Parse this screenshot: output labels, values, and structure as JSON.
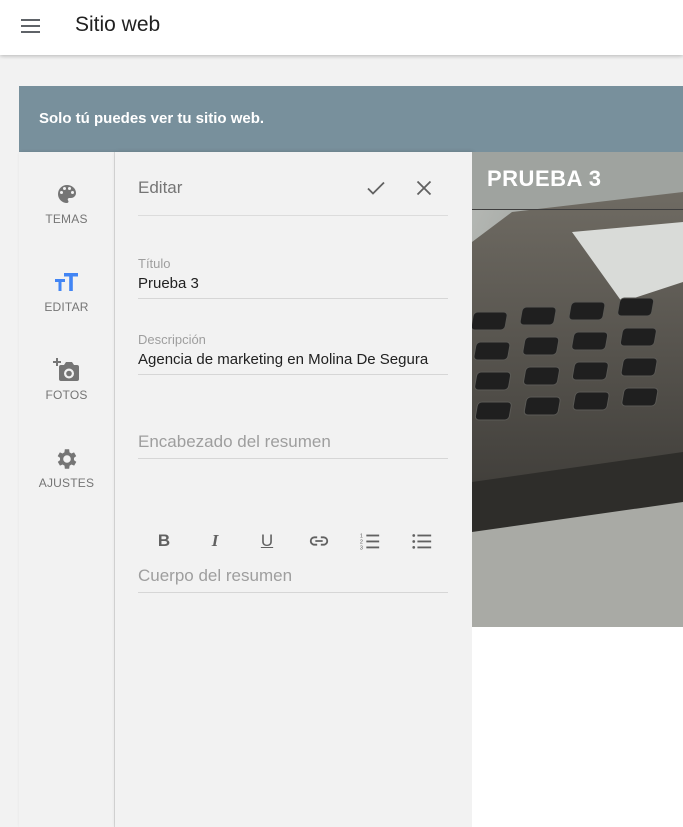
{
  "app": {
    "title": "Sitio web"
  },
  "banner": {
    "text": "Solo tú puedes ver tu sitio web."
  },
  "rail": {
    "items": [
      {
        "label": "TEMAS",
        "icon": "palette-icon"
      },
      {
        "label": "EDITAR",
        "icon": "text-fields-icon",
        "active": true,
        "color": "#4285f4"
      },
      {
        "label": "FOTOS",
        "icon": "add-photo-icon"
      },
      {
        "label": "AJUSTES",
        "icon": "gear-icon"
      }
    ]
  },
  "editor": {
    "title": "Editar",
    "title_field": {
      "label": "Título",
      "value": "Prueba 3"
    },
    "description_field": {
      "label": "Descripción",
      "value": "Agencia de marketing en Molina De Segura"
    },
    "summary_heading": {
      "placeholder": "Encabezado del resumen"
    },
    "summary_body": {
      "placeholder": "Cuerpo del resumen"
    },
    "toolbar": [
      "bold-icon",
      "italic-icon",
      "underline-icon",
      "link-icon",
      "numbered-list-icon",
      "bulleted-list-icon"
    ]
  },
  "preview": {
    "title": "PRUEBA 3"
  }
}
